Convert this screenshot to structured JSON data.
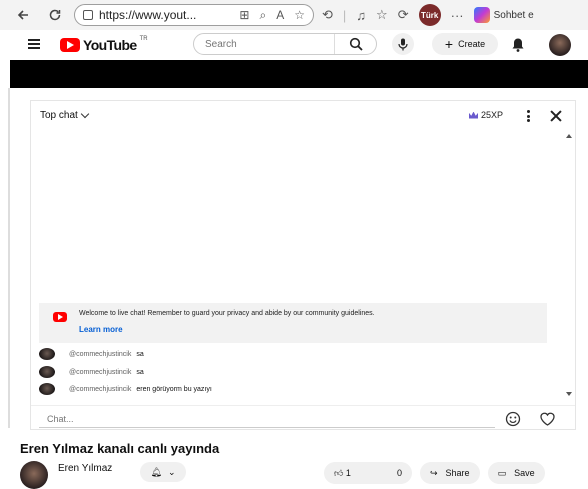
{
  "browser": {
    "url": "https://www.yout...",
    "profile_label": "Türk",
    "sidebar_label": "Sohbet e"
  },
  "header": {
    "logo_text": "YouTube",
    "logo_tm": "TR",
    "search_placeholder": "Search",
    "create_label": "Create"
  },
  "chat": {
    "mode_label": "Top chat",
    "xp_label": "25XP",
    "welcome_text": "Welcome to live chat! Remember to guard your privacy and abide by our community guidelines.",
    "learn_more": "Learn more",
    "messages": [
      {
        "author": "@commechjustincik",
        "text": "sa"
      },
      {
        "author": "@commechjustincik",
        "text": "sa"
      },
      {
        "author": "@commechjustincik",
        "text": "eren görüyorm bu yazıyı"
      }
    ],
    "input_placeholder": "Chat..."
  },
  "video": {
    "title": "Eren Yılmaz kanalı canlı yayında",
    "channel_name": "Eren Yılmaz",
    "likes": "1",
    "dislikes": "0",
    "share_label": "Share",
    "save_label": "Save"
  }
}
